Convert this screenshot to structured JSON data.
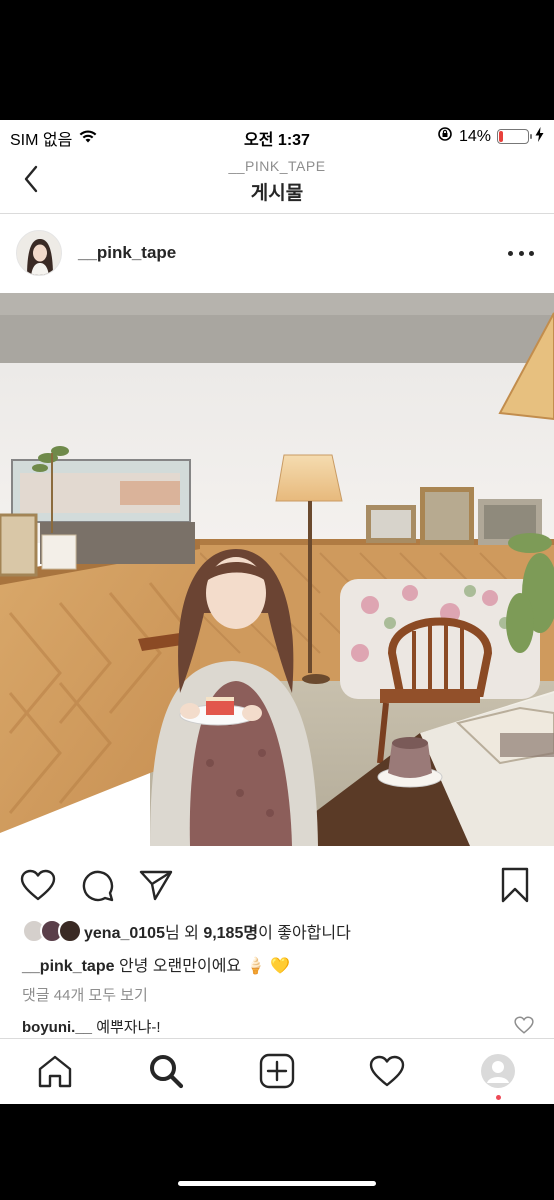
{
  "status_bar": {
    "carrier": "SIM 없음",
    "time": "오전 1:37",
    "battery_percent": "14%",
    "battery_level": 0.14,
    "icons": [
      "wifi-icon",
      "orientation-lock-icon",
      "battery-icon",
      "charging-icon"
    ]
  },
  "nav": {
    "subtitle": "__PINK_TAPE",
    "title": "게시물",
    "back_icon": "chevron-left-icon"
  },
  "post": {
    "username": "__pink_tape",
    "more_icon": "more-horizontal-icon"
  },
  "actions": {
    "icons": [
      "heart-icon",
      "comment-icon",
      "share-icon",
      "bookmark-icon"
    ]
  },
  "likes": {
    "liker": "yena_0105",
    "text_mid": "님 외 ",
    "count": "9,185명",
    "text_end": "이 좋아합니다"
  },
  "caption": {
    "username": "__pink_tape",
    "text": "안녕 오랜만이에요 🍦 💛"
  },
  "view_comments": "댓글 44개 모두 보기",
  "comment": {
    "username": "boyuni.__",
    "text": "예뿌자냐-!"
  },
  "tabbar": {
    "icons": [
      "home-icon",
      "search-icon",
      "add-post-icon",
      "activity-heart-icon",
      "profile-icon"
    ]
  },
  "colors": {
    "text": "#262626",
    "secondary": "#8e8e8e",
    "divider": "#dbdbdb",
    "notification": "#ed4956",
    "battery_low": "#e8413c"
  }
}
